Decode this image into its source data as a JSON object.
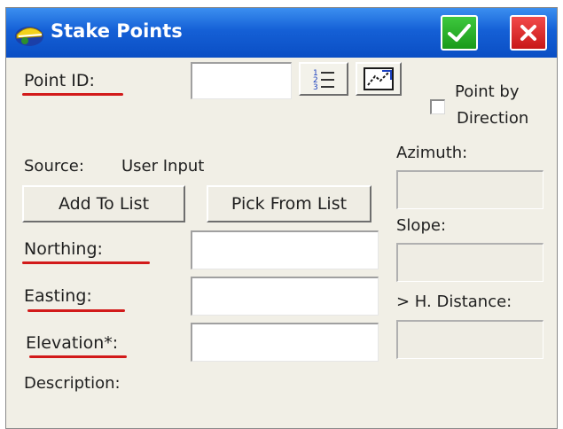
{
  "window": {
    "title": "Stake Points",
    "ok_icon": "check-icon",
    "close_icon": "close-icon"
  },
  "form": {
    "point_id": {
      "label": "Point ID:",
      "value": ""
    },
    "point_by_direction": {
      "label_line1": "Point by",
      "label_line2": "Direction",
      "checked": false
    },
    "source": {
      "label": "Source:",
      "value": "User Input"
    },
    "add_to_list_label": "Add To List",
    "pick_from_list_label": "Pick From List",
    "northing": {
      "label": "Northing:",
      "value": ""
    },
    "easting": {
      "label": "Easting:",
      "value": ""
    },
    "elevation": {
      "label": "Elevation*:",
      "value": ""
    },
    "description": {
      "label": "Description:"
    },
    "azimuth": {
      "label": "Azimuth:",
      "value": ""
    },
    "slope": {
      "label": "Slope:",
      "value": ""
    },
    "h_distance": {
      "label": "> H. Distance:",
      "value": ""
    }
  },
  "colors": {
    "titlebar": "#1560d6",
    "ok_button": "#2db82d",
    "close_button": "#e02828",
    "annotation_underline": "#d21a1a",
    "dialog_background": "#f1efe6"
  }
}
